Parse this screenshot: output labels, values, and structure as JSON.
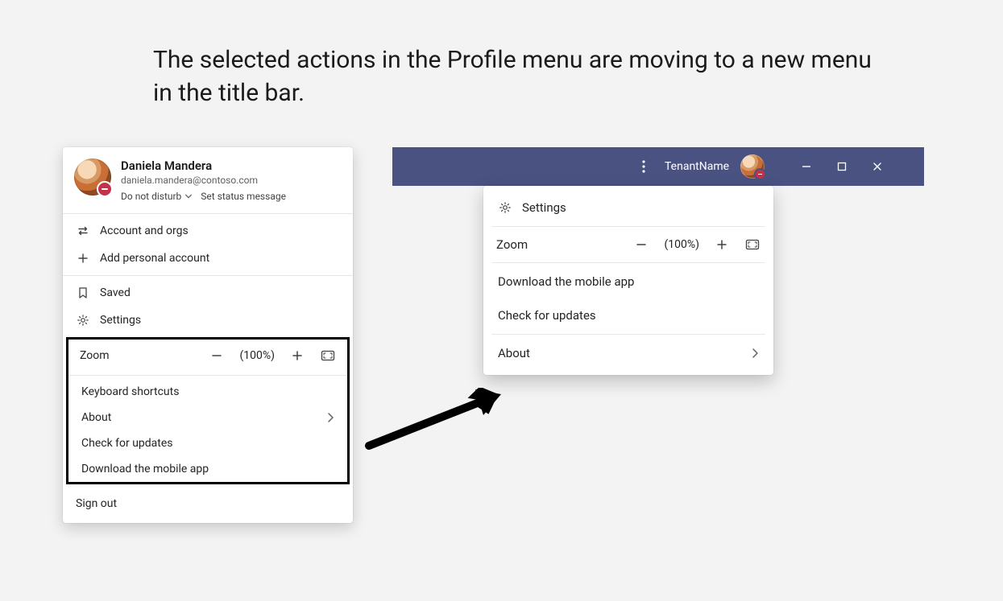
{
  "headline": "The selected actions in the Profile menu are moving to a new menu in the title bar.",
  "profile": {
    "name": "Daniela Mandera",
    "email": "daniela.mandera@contoso.com",
    "presence_label": "Do not disturb",
    "set_status_label": "Set status message",
    "items_top": [
      {
        "icon": "swap-icon",
        "label": "Account and orgs"
      },
      {
        "icon": "plus-icon",
        "label": "Add personal account"
      }
    ],
    "items_mid": [
      {
        "icon": "bookmark-icon",
        "label": "Saved"
      },
      {
        "icon": "gear-icon",
        "label": "Settings"
      }
    ],
    "zoom": {
      "label": "Zoom",
      "value": "(100%)"
    },
    "items_highlight": [
      {
        "label": "Keyboard shortcuts",
        "chevron": false
      },
      {
        "label": "About",
        "chevron": true
      },
      {
        "label": "Check for updates",
        "chevron": false
      },
      {
        "label": "Download the mobile app",
        "chevron": false
      }
    ],
    "signout_label": "Sign out"
  },
  "titlebar": {
    "tenant": "TenantName"
  },
  "new_menu": {
    "settings_label": "Settings",
    "zoom": {
      "label": "Zoom",
      "value": "(100%)"
    },
    "download_label": "Download the mobile app",
    "updates_label": "Check for updates",
    "about_label": "About"
  }
}
